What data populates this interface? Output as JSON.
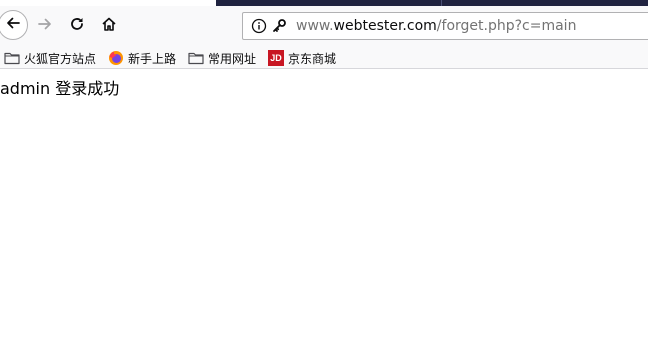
{
  "toolbar": {
    "back_icon": "arrow-left-icon",
    "forward_icon": "arrow-right-icon",
    "reload_icon": "reload-icon",
    "home_icon": "home-icon"
  },
  "urlbar": {
    "url_prefix": "www.",
    "url_host": "webtester.com",
    "url_path": "/forget.php?c=main",
    "info_icon": "info-icon",
    "key_icon": "key-icon"
  },
  "bookmarks": {
    "items": [
      {
        "label": "火狐官方站点",
        "icon": "folder-icon"
      },
      {
        "label": "新手上路",
        "icon": "firefox-icon"
      },
      {
        "label": "常用网址",
        "icon": "folder-icon"
      },
      {
        "label": "京东商城",
        "icon": "jd-icon",
        "icon_text": "JD",
        "icon_color": "#c81623"
      }
    ]
  },
  "page": {
    "message": "admin 登录成功"
  },
  "colors": {
    "tabstrip": "#202340",
    "toolbar_bg": "#f9f9fa",
    "text": "#0c0c0d",
    "jd_red": "#c81623"
  }
}
